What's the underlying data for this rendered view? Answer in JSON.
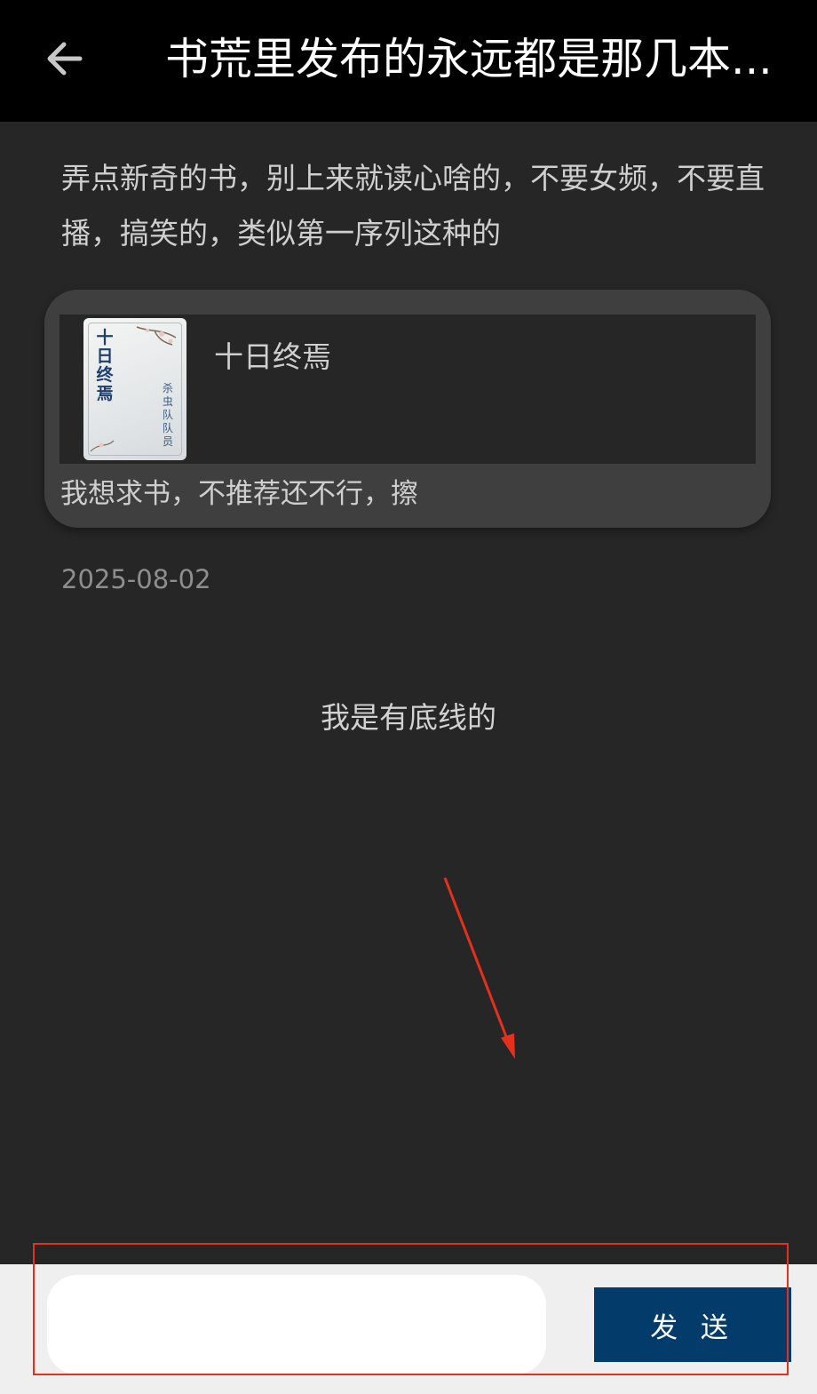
{
  "header": {
    "title": "书荒里发布的永远都是那几本...",
    "back_icon": "arrow-left-icon"
  },
  "post": {
    "body": "弄点新奇的书，别上来就读心啥的，不要女频，不要直播，搞笑的，类似第一序列这种的",
    "date": "2025-08-02"
  },
  "book_card": {
    "book_title": "十日终焉",
    "cover_title": "十日终焉",
    "cover_author": "杀虫队队员",
    "comment": "我想求书，不推荐还不行，擦"
  },
  "reply": {
    "text": "我是有底线的"
  },
  "composer": {
    "input_value": "",
    "input_placeholder": "",
    "send_label": "发 送"
  },
  "colors": {
    "header_bg": "#000000",
    "page_bg": "#262626",
    "card_bg": "#3f3f3f",
    "send_button": "#033c6b",
    "annotation": "#e4301c"
  }
}
